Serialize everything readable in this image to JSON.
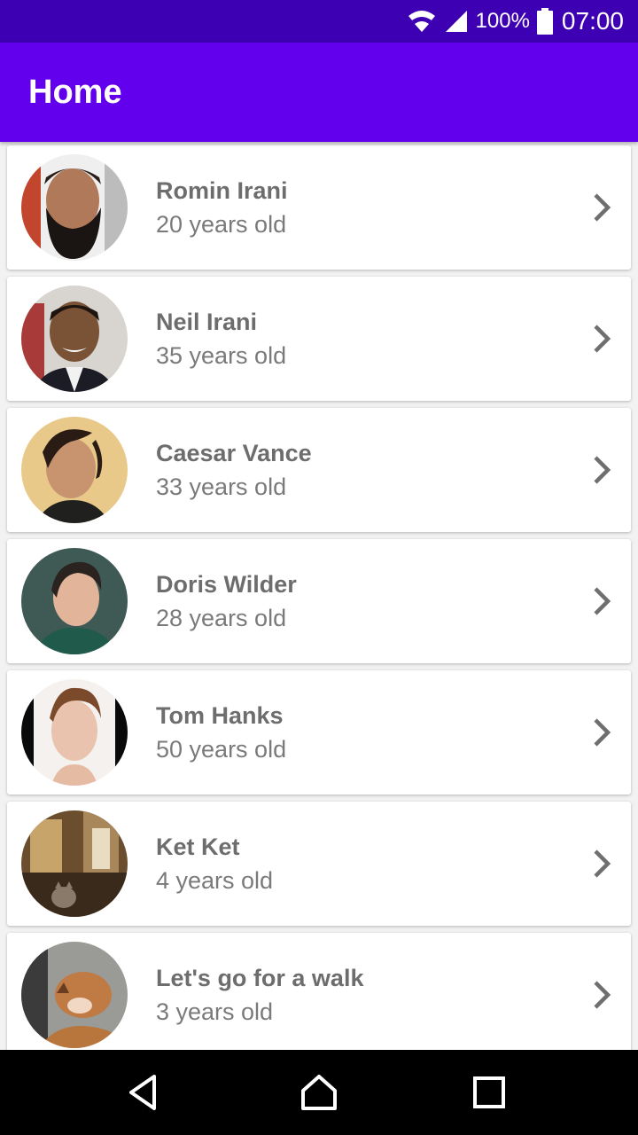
{
  "status_bar": {
    "battery_percent": "100%",
    "time": "07:00",
    "icons": [
      "wifi-icon",
      "signal-icon",
      "battery-icon"
    ]
  },
  "app_bar": {
    "title": "Home",
    "color": "#6200ee"
  },
  "people": [
    {
      "name": "Romin Irani",
      "age": "20 years old"
    },
    {
      "name": "Neil Irani",
      "age": "35 years old"
    },
    {
      "name": "Caesar Vance",
      "age": "33 years old"
    },
    {
      "name": "Doris Wilder",
      "age": "28 years old"
    },
    {
      "name": "Tom Hanks",
      "age": "50 years old"
    },
    {
      "name": "Ket Ket",
      "age": "4 years old"
    },
    {
      "name": "Let's go for a walk",
      "age": "3 years old"
    }
  ],
  "nav_bar": {
    "icons": [
      "back-icon",
      "home-icon",
      "recents-icon"
    ]
  }
}
